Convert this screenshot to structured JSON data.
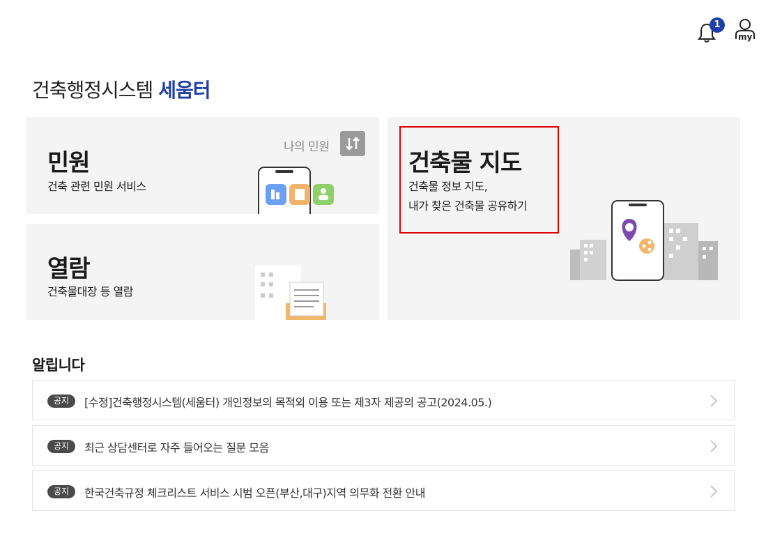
{
  "header": {
    "notification_count": "1",
    "user_label": "my"
  },
  "page": {
    "title_main": "건축행정시스템 ",
    "title_accent": "세움터"
  },
  "cards": {
    "minwon": {
      "title": "민원",
      "desc": "건축 관련 민원 서비스",
      "my_link": "나의 민원"
    },
    "yeolram": {
      "title": "열람",
      "desc": "건축물대장 등 열람"
    },
    "map": {
      "title": "건축물 지도",
      "desc_line1": "건축물 정보 지도,",
      "desc_line2": "내가 찾은 건축물 공유하기"
    }
  },
  "notices": {
    "heading": "알립니다",
    "items": [
      {
        "tag": "공지",
        "text": "[수정]건축행정시스템(세움터) 개인정보의 목적외 이용 또는 제3자 제공의 공고(2024.05.)"
      },
      {
        "tag": "공지",
        "text": "최근 상담센터로 자주 들어오는 질문 모음"
      },
      {
        "tag": "공지",
        "text": "한국건축규정 체크리스트 서비스 시범 오픈(부산,대구)지역 의무화 전환 안내"
      }
    ]
  },
  "colors": {
    "accent": "#1f3fa8",
    "card_bg": "#f4f4f4",
    "highlight": "#e00000",
    "tag_bg": "#4a4a4a"
  },
  "icons": [
    "bell-icon",
    "user-icon",
    "swap-icon",
    "phone-illustration",
    "map-pin-icon",
    "share-icon",
    "document-illustration",
    "chevron-right-icon"
  ]
}
